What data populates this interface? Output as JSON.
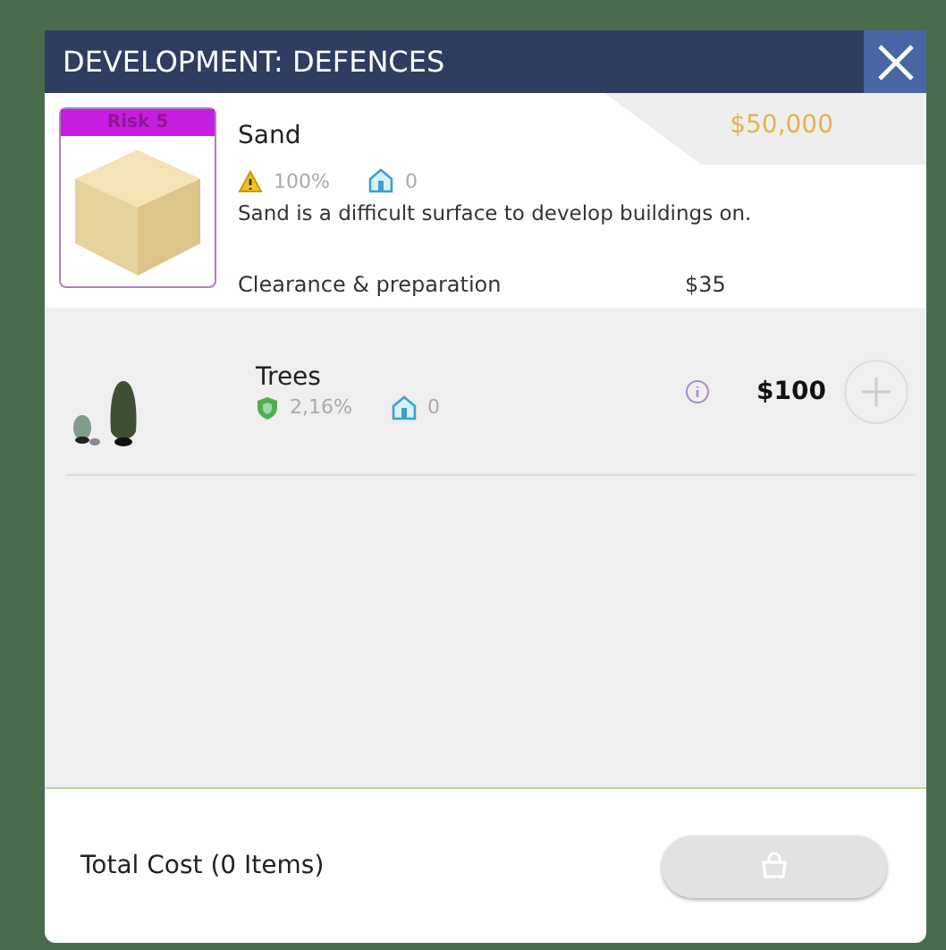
{
  "window": {
    "title": "DEVELOPMENT: DEFENCES"
  },
  "tile": {
    "risk": "Risk 5",
    "name": "Sand",
    "hazard": "100%",
    "buildings": "0",
    "price": "$50,000",
    "description": "Sand is a difficult surface to develop buildings on.",
    "cost_label": "Clearance & preparation",
    "cost": "$35"
  },
  "items": [
    {
      "name": "Trees",
      "protection": "2,16%",
      "buildings": "0",
      "price": "$100"
    }
  ],
  "footer": {
    "total_label": "Total Cost (0 Items)",
    "buy_disabled": true
  }
}
